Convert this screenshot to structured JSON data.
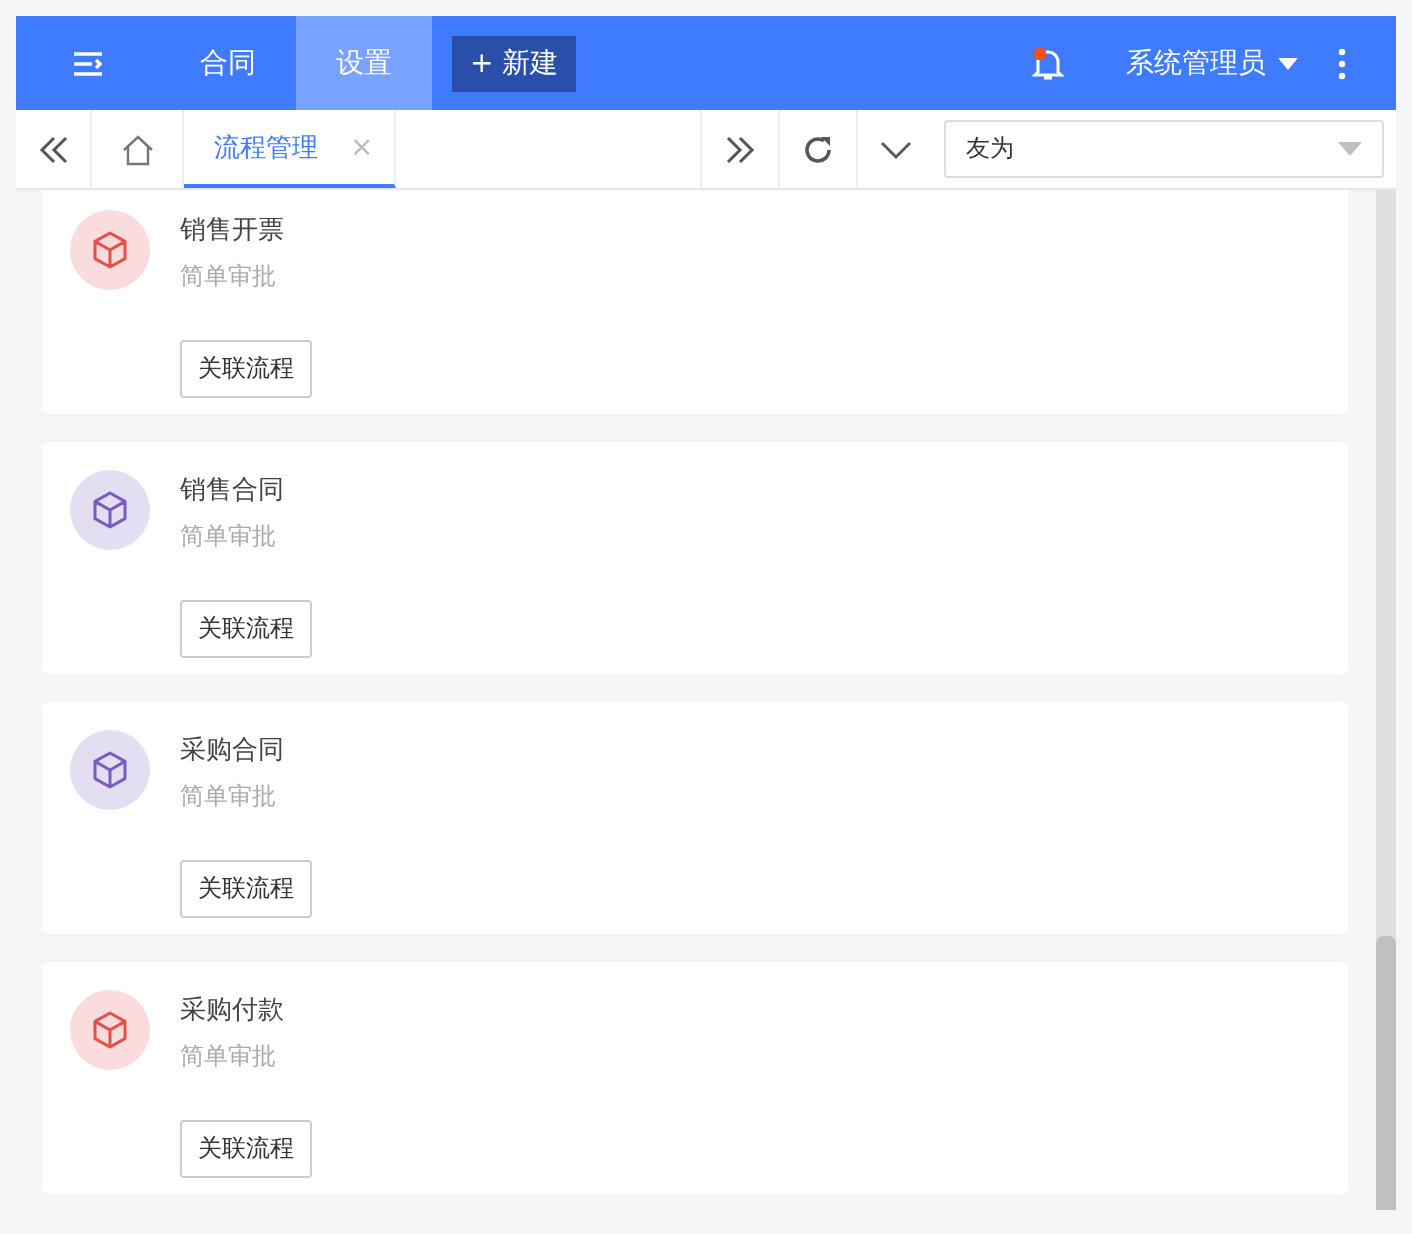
{
  "top_bar": {
    "menu": [
      {
        "label": "合同",
        "selected": false
      },
      {
        "label": "设置",
        "selected": true
      }
    ],
    "new_button": "+ 新建",
    "user": "系统管理员"
  },
  "tab_bar": {
    "tabs": [
      {
        "label": "流程管理",
        "selected": true
      }
    ],
    "close": "×",
    "select_value": "友为"
  },
  "cards": [
    {
      "title": "销售开票",
      "subtitle": "简单审批",
      "button": "关联流程",
      "color": "#e0524a"
    },
    {
      "title": "销售合同",
      "subtitle": "简单审批",
      "button": "关联流程",
      "color": "#7a5cc0"
    },
    {
      "title": "采购合同",
      "subtitle": "简单审批",
      "button": "关联流程",
      "color": "#7a5cc0"
    },
    {
      "title": "采购付款",
      "subtitle": "简单审批",
      "button": "关联流程",
      "color": "#e0524a"
    }
  ]
}
